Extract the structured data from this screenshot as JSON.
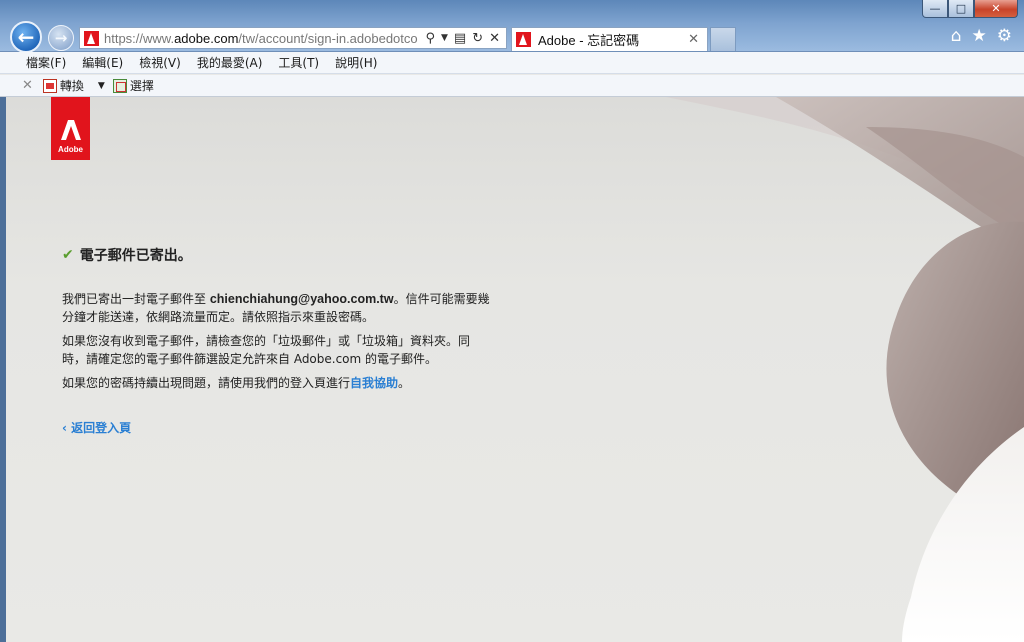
{
  "window": {
    "minimize_label": "—",
    "maximize_label": "□",
    "close_label": "✕"
  },
  "nav": {
    "back_glyph": "←",
    "forward_glyph": "→"
  },
  "address": {
    "url_prefix": "https://www.",
    "url_domain": "adobe.com",
    "url_path": "/tw/account/sign-in.adobedotco",
    "icons": [
      "search-icon",
      "dropdown-icon",
      "compat-icon",
      "refresh-icon",
      "stop-icon"
    ]
  },
  "tab": {
    "title": "Adobe - 忘記密碼",
    "close_glyph": "✕"
  },
  "toolbar_right": {
    "home_glyph": "⌂",
    "favorites_glyph": "★",
    "tools_glyph": "⚙"
  },
  "menubar": {
    "items": [
      "檔案(F)",
      "編輯(E)",
      "檢視(V)",
      "我的最愛(A)",
      "工具(T)",
      "說明(H)"
    ]
  },
  "cmdbar": {
    "close_glyph": "✕",
    "convert_label": "轉換",
    "select_label": "選擇"
  },
  "logo": {
    "wordmark": "Adobe"
  },
  "content": {
    "heading": "電子郵件已寄出。",
    "p1_before": "我們已寄出一封電子郵件至 ",
    "p1_email": "chienchiahung@yahoo.com.tw",
    "p1_after": "。信件可能需要幾分鐘才能送達，依網路流量而定。請依照指示來重設密碼。",
    "p2": "如果您沒有收到電子郵件，請檢查您的「垃圾郵件」或「垃圾箱」資料夾。同時，請確定您的電子郵件篩選設定允許來自 Adobe.com 的電子郵件。",
    "p3_before": "如果您的密碼持續出現問題，請使用我們的登入頁進行",
    "p3_link": "自我協助",
    "p3_after": "。",
    "back_link": "‹ 返回登入頁"
  },
  "colors": {
    "adobe_red": "#e1141c",
    "link_blue": "#2a7fd3",
    "check_green": "#5a9e2f"
  }
}
